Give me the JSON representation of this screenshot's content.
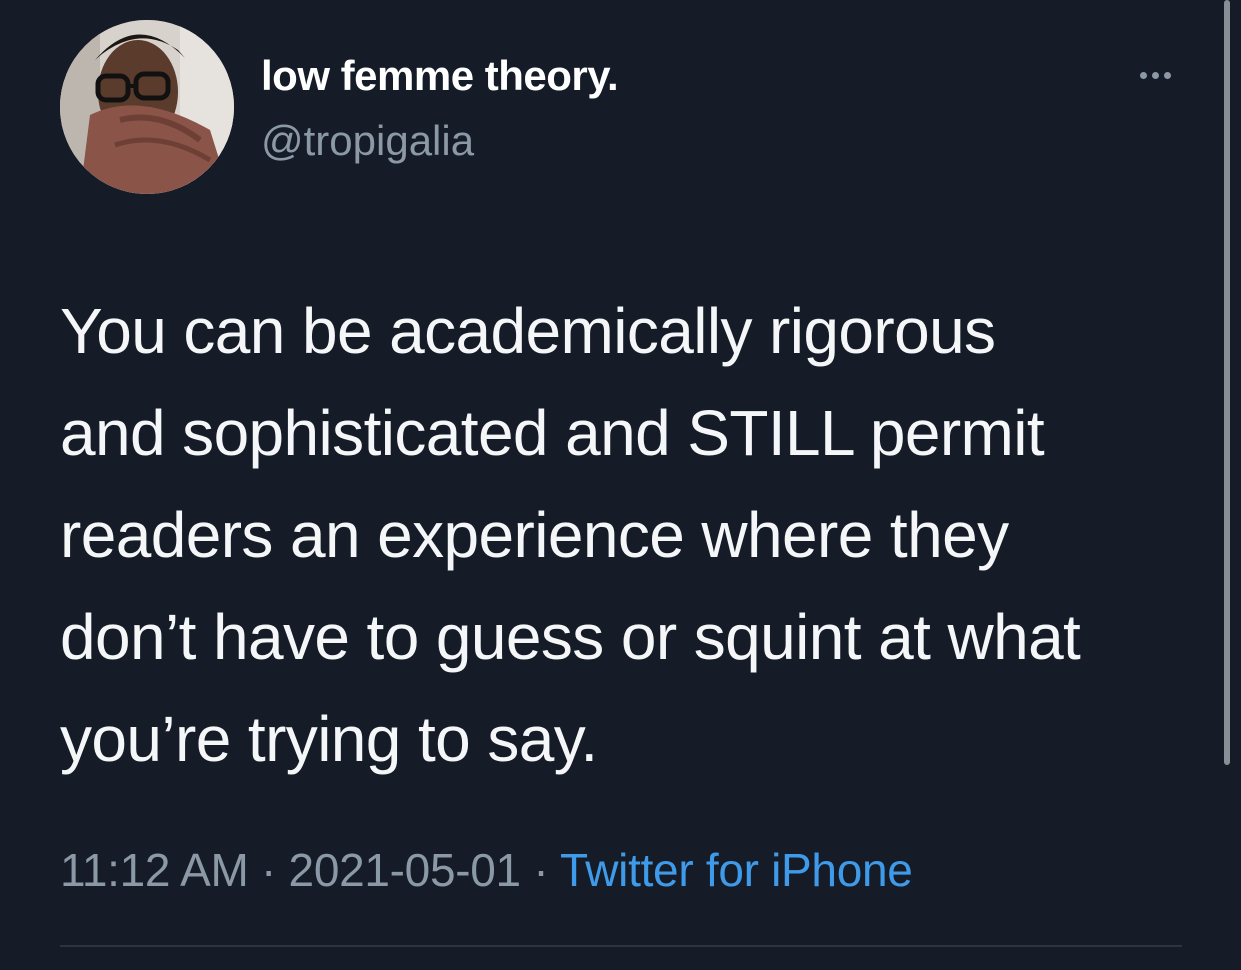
{
  "author": {
    "display_name": "low femme theory.",
    "handle": "@tropigalia",
    "avatar_icon": "profile-photo"
  },
  "menu": {
    "more_icon": "more-horizontal-icon"
  },
  "tweet": {
    "text": "You can be academically rigorous\nand sophisticated and STILL permit\nreaders an experience where they\ndon’t have to guess or squint at what\nyou’re trying to say."
  },
  "meta": {
    "time": "11:12 AM",
    "separator": " · ",
    "date": "2021-05-01",
    "source": "Twitter for iPhone"
  },
  "colors": {
    "background": "#151c27",
    "text": "#f4f6f8",
    "secondary_text": "#8b98a5",
    "link": "#3f9bea"
  }
}
